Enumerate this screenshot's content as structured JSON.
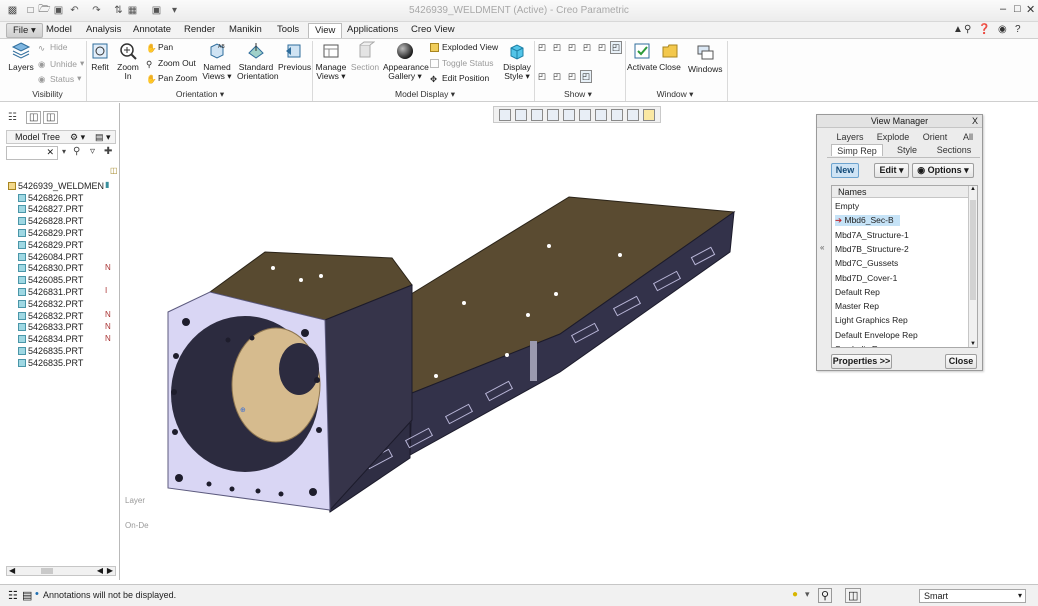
{
  "app": {
    "title": "5426939_WELDMENT (Active) - Creo Parametric"
  },
  "tabs": [
    {
      "label": "File"
    },
    {
      "label": "Model"
    },
    {
      "label": "Analysis"
    },
    {
      "label": "Annotate"
    },
    {
      "label": "Render"
    },
    {
      "label": "Manikin"
    },
    {
      "label": "Tools"
    },
    {
      "label": "View"
    },
    {
      "label": "Applications"
    },
    {
      "label": "Creo View"
    }
  ],
  "ribbon": {
    "visibility": {
      "group": "Visibility",
      "layers": "Layers",
      "hide": "Hide",
      "unhide": "Unhide",
      "status": "Status"
    },
    "orientation": {
      "group": "Orientation",
      "refit": "Refit",
      "zoom_in": "Zoom In",
      "pan": "Pan",
      "zoom_out": "Zoom Out",
      "pan_zoom": "Pan Zoom",
      "named_views": "Named Views",
      "standard_orientation": "Standard Orientation",
      "previous": "Previous"
    },
    "model_display": {
      "group": "Model Display",
      "manage_views": "Manage Views",
      "section": "Section",
      "appearance_gallery": "Appearance Gallery",
      "exploded_view": "Exploded View",
      "toggle_status": "Toggle Status",
      "edit_position": "Edit Position",
      "display_style": "Display Style"
    },
    "show": {
      "group": "Show"
    },
    "window": {
      "group": "Window",
      "activate": "Activate",
      "close": "Close",
      "windows": "Windows"
    }
  },
  "model_tree": {
    "title": "Model Tree",
    "root": "5426939_WELDMEN",
    "items": [
      {
        "name": "5426826.PRT",
        "flag": ""
      },
      {
        "name": "5426827.PRT",
        "flag": ""
      },
      {
        "name": "5426828.PRT",
        "flag": ""
      },
      {
        "name": "5426829.PRT",
        "flag": ""
      },
      {
        "name": "5426829.PRT",
        "flag": ""
      },
      {
        "name": "5426084.PRT",
        "flag": ""
      },
      {
        "name": "5426830.PRT",
        "flag": "N"
      },
      {
        "name": "5426085.PRT",
        "flag": ""
      },
      {
        "name": "5426831.PRT",
        "flag": "I"
      },
      {
        "name": "5426832.PRT",
        "flag": ""
      },
      {
        "name": "5426832.PRT",
        "flag": "N"
      },
      {
        "name": "5426833.PRT",
        "flag": "N"
      },
      {
        "name": "5426834.PRT",
        "flag": "N"
      },
      {
        "name": "5426835.PRT",
        "flag": ""
      },
      {
        "name": "5426835.PRT",
        "flag": ""
      }
    ]
  },
  "graphics": {
    "hint_layer": "Layer",
    "hint_ondemand": "On-De"
  },
  "view_manager": {
    "title": "View Manager",
    "close_x": "X",
    "tabs_top": [
      "Layers",
      "Explode",
      "Orient",
      "All"
    ],
    "tabs_bottom": [
      "Simp Rep",
      "Style",
      "Sections"
    ],
    "active_tab": "Simp Rep",
    "new_label": "New",
    "edit_label": "Edit",
    "options_label": "Options",
    "names_header": "Names",
    "items": [
      {
        "label": "Empty"
      },
      {
        "label": "Mbd6_Sec-B"
      },
      {
        "label": "Mbd7A_Structure-1"
      },
      {
        "label": "Mbd7B_Structure-2"
      },
      {
        "label": "Mbd7C_Gussets"
      },
      {
        "label": "Mbd7D_Cover-1"
      },
      {
        "label": "Default Rep"
      },
      {
        "label": "Master Rep"
      },
      {
        "label": "Light Graphics Rep"
      },
      {
        "label": "Default Envelope Rep"
      },
      {
        "label": "Symbolic Rep"
      }
    ],
    "selected_index": 1,
    "properties_label": "Properties >>",
    "close_label": "Close"
  },
  "status": {
    "message": "Annotations will not be displayed.",
    "filter": "Smart"
  },
  "colors": {
    "accent": "#1f6fb2",
    "model_dark": "#36344a",
    "model_top": "#5a4b31",
    "face_lavender": "#d9d6f4",
    "face_tan": "#d6bb8e"
  }
}
